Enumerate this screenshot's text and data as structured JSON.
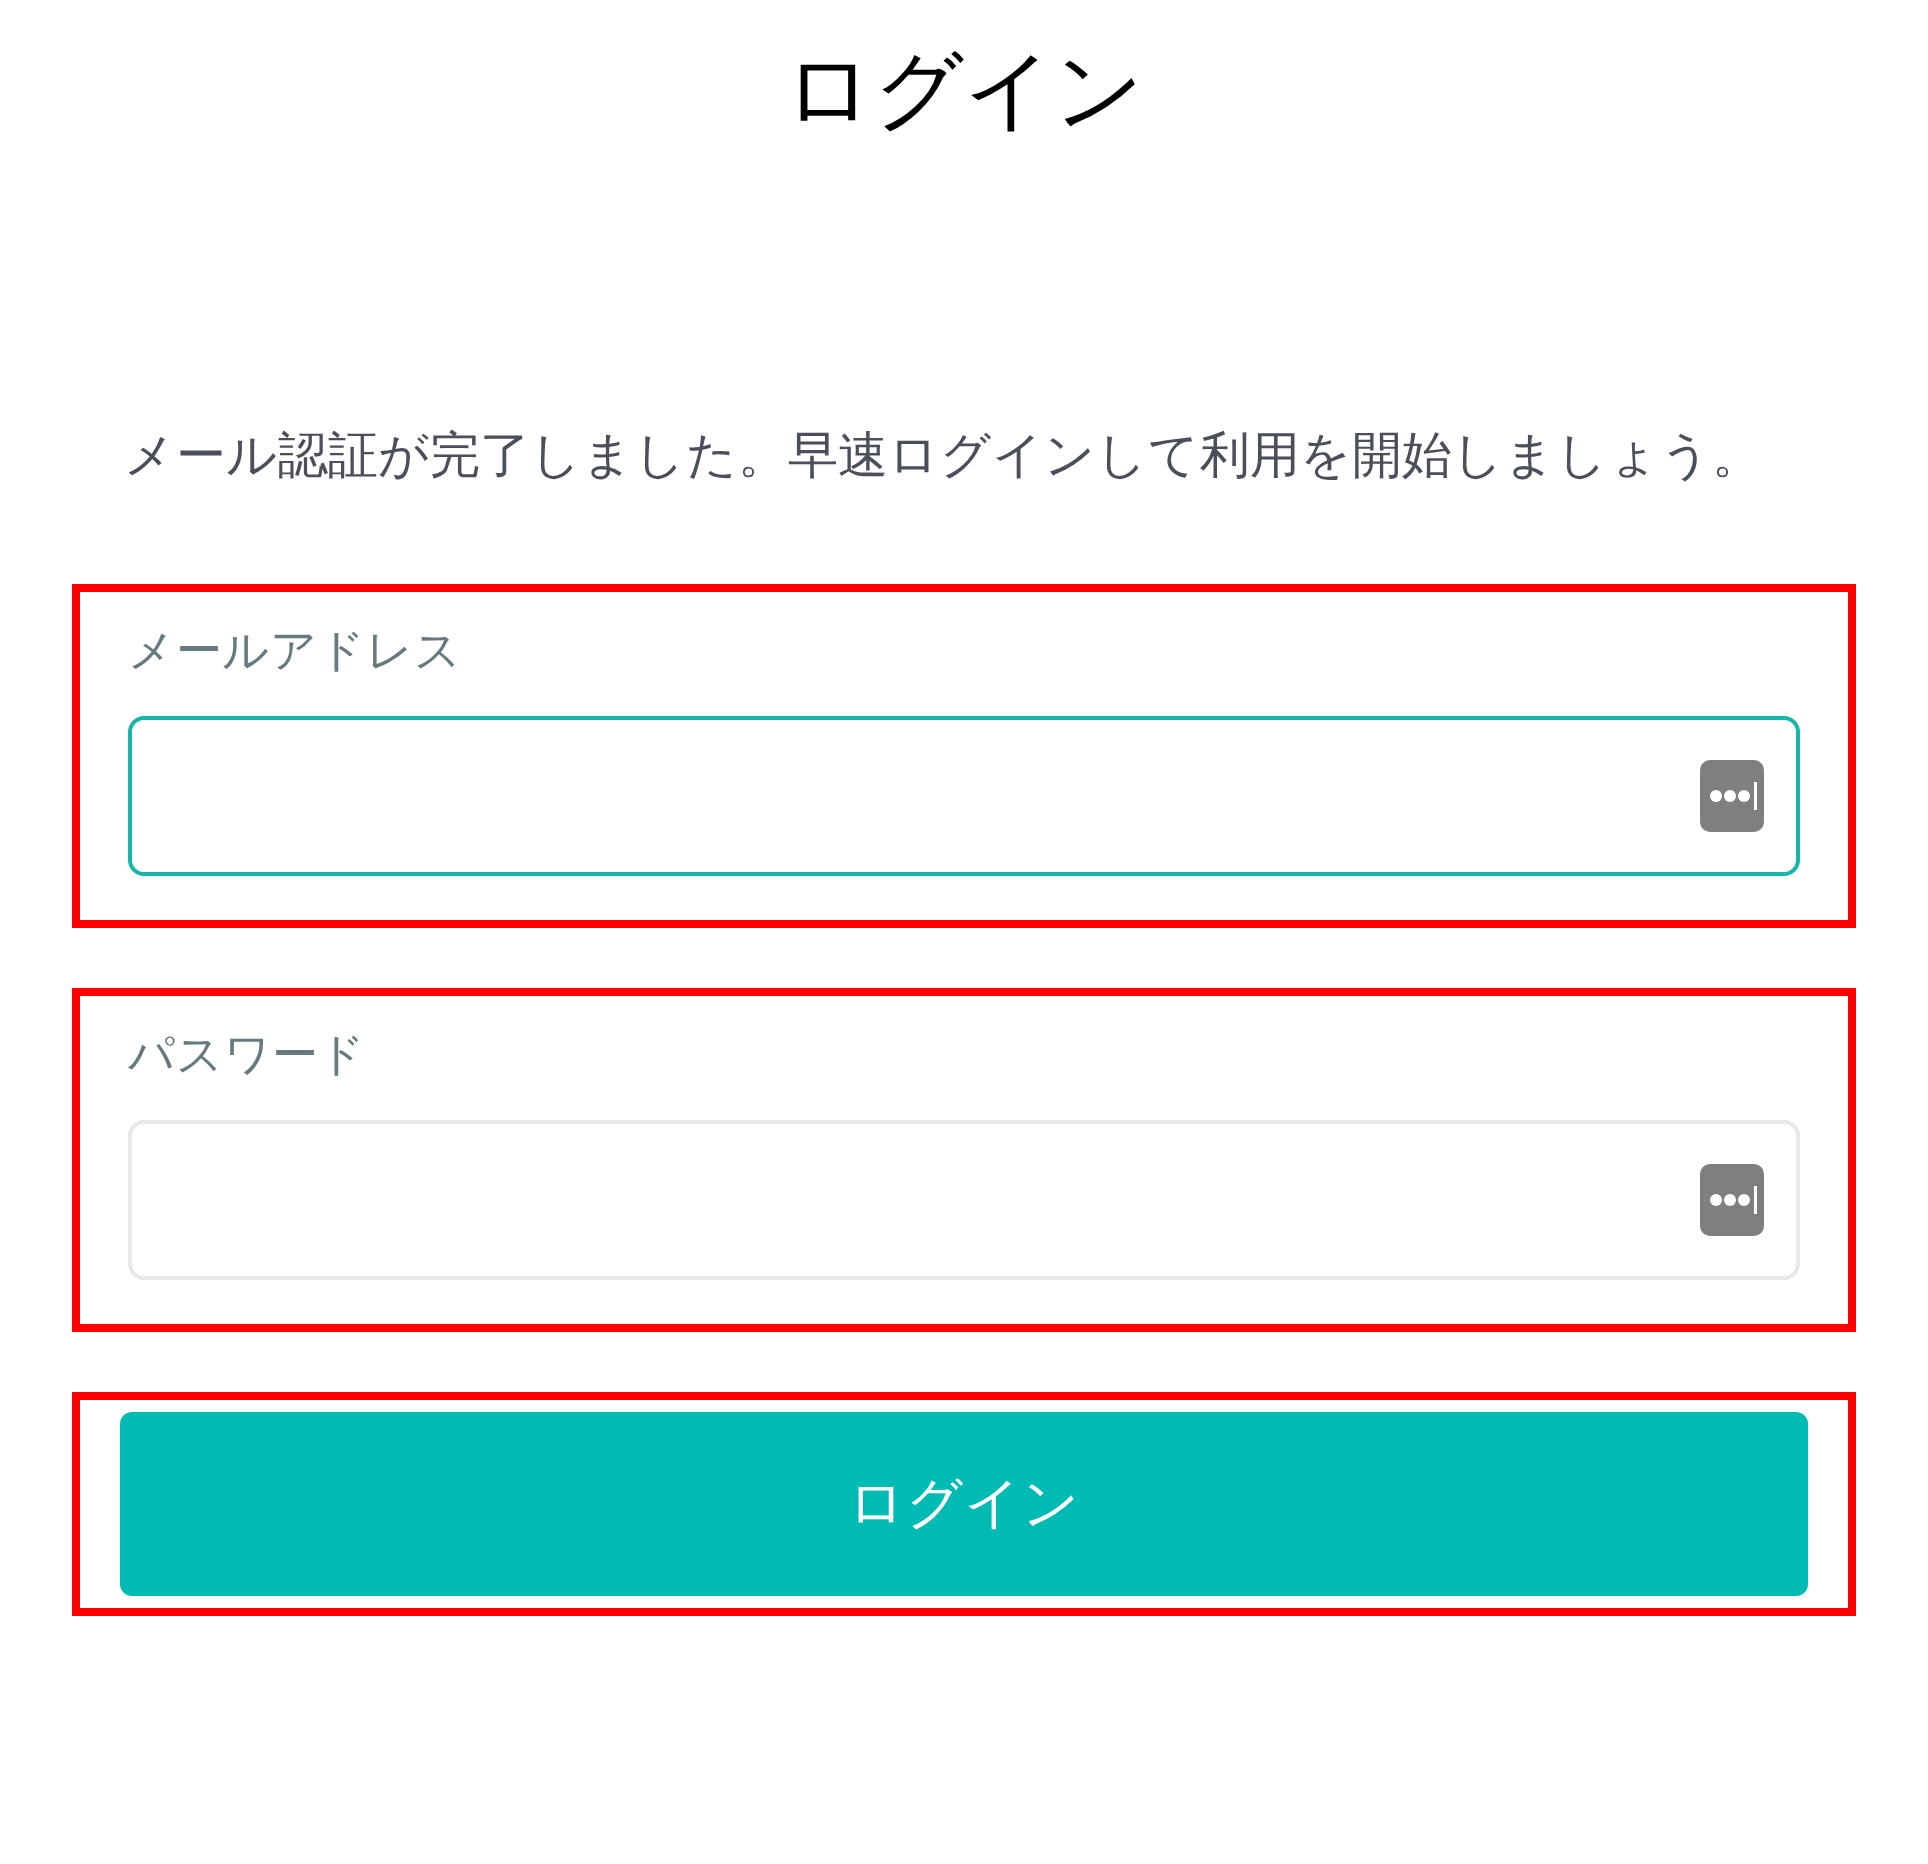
{
  "title": "ログイン",
  "message": "メール認証が完了しました。早速ログインして利用を開始しましょう。",
  "fields": [
    {
      "label": "メールアドレス",
      "focused": true,
      "highlighted": true
    },
    {
      "label": "パスワード",
      "focused": false,
      "highlighted": true
    }
  ],
  "button": {
    "label": "ログイン",
    "highlighted": true
  }
}
